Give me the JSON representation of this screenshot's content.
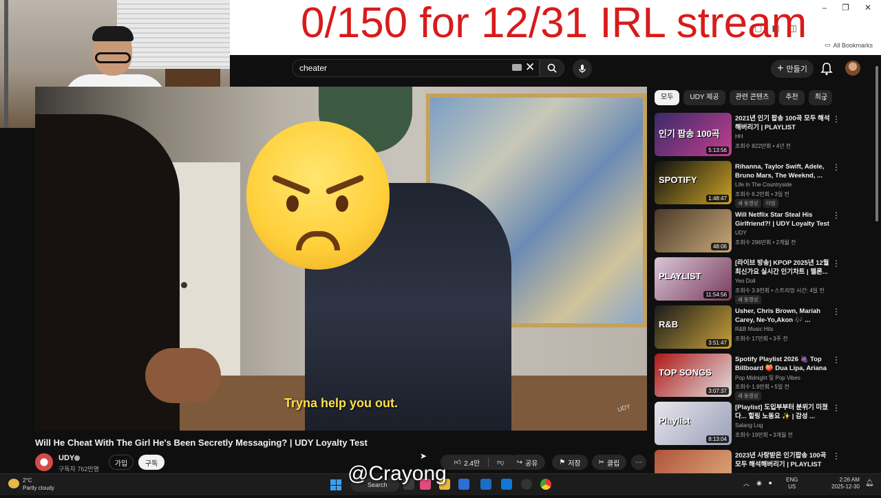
{
  "overlay": {
    "banner_text": "0/150 for 12/31 IRL stream"
  },
  "browser": {
    "bookmarks_label": "All Bookmarks",
    "window_buttons": [
      "–",
      "❐",
      "✕"
    ]
  },
  "header": {
    "search_value": "cheater",
    "clear_symbol": "✕",
    "create_label": "만들기",
    "create_symbol": "+"
  },
  "video": {
    "subtitle": "Tryna help you out.",
    "title": "Will He Cheat With The Girl He's Been Secretly Messaging? | UDY Loyalty Test",
    "channel": "UDY",
    "subscribers": "구독자 762만명",
    "join_label": "가입",
    "subscribe_label": "구독",
    "likes": "2.4만",
    "share_label": "공유",
    "save_label": "저장",
    "clip_label": "클립",
    "more_symbol": "⋯"
  },
  "chips": [
    "모두",
    "UDY 제공",
    "관련 콘텐츠",
    "추천",
    "최근"
  ],
  "recommendations": [
    {
      "title": "2021년 인기 팝송 100곡 모두 해석 해버리기 | PLAYLIST",
      "channel": "HH",
      "meta": "조회수 822만회 • 4년 전",
      "duration": "5:13:56",
      "thumb_text": "인기 팝송 100곡",
      "colors": [
        "#3b2a6b",
        "#c23f8c"
      ]
    },
    {
      "title": "Rihanna, Taylor Swift, Adele, Bruno Mars, The Weeknd, ...",
      "channel": "Life In The Countryside",
      "meta": "조회수 6.2만회 • 3일 전",
      "duration": "1:48:47",
      "badge": "새 동영상",
      "badge2": "더빙",
      "thumb_text": "SPOTIFY",
      "colors": [
        "#101010",
        "#c9a227"
      ]
    },
    {
      "title": "Will Netflix Star Steal His Girlfriend?! | UDY Loyalty Test",
      "channel": "UDY",
      "meta": "조회수 296만회 • 2개월 전",
      "duration": "48:06",
      "thumb_text": "",
      "colors": [
        "#4a3a2a",
        "#c9a878"
      ]
    },
    {
      "title": "[라이브 방송] KPOP 2025년 12월 최신가요 실시간 인기차트 | 멜론...",
      "channel": "Yeo Doll",
      "meta": "조회수 3.9천회 • 스트리밍 시간: 4일 전",
      "duration": "11:54:56",
      "badge": "새 동영상",
      "thumb_text": "PLAYLIST",
      "colors": [
        "#d8c7d6",
        "#7a3b5d"
      ]
    },
    {
      "title": "Usher, Chris Brown, Mariah Carey, Ne-Yo,Akon 🎶 ...",
      "channel": "R&B Music Hits",
      "meta": "조회수 17만회 • 3주 전",
      "duration": "3:51:47",
      "thumb_text": "R&B",
      "colors": [
        "#1b1b1b",
        "#c7a03a"
      ]
    },
    {
      "title": "Spotify Playlist 2026 🍇 Top Billboard 🍑 Dua Lipa, Ariana ...",
      "channel": "Pop Midnight 및 Pop Vibes",
      "meta": "조회수 1.9만회 • 5일 전",
      "duration": "3:07:37",
      "badge": "새 동영상",
      "thumb_text": "TOP SONGS",
      "colors": [
        "#b01818",
        "#e0e0e0"
      ]
    },
    {
      "title": "[Playlist] 도입부부터 분위기 미쳤다... 힐링 노동요 ✨ | 감성 ...",
      "channel": "Salang Log",
      "meta": "조회수 19만회 • 3개월 전",
      "duration": "8:13:04",
      "thumb_text": "Playlist",
      "colors": [
        "#e8e4ec",
        "#9aa0b8"
      ]
    },
    {
      "title": "2023년 사랑받은 인기팝송 100곡 모두 해석해버리기 | PLAYLIST",
      "channel": "",
      "meta": "",
      "duration": "",
      "thumb_text": "",
      "colors": [
        "#b0533a",
        "#e0b080"
      ]
    }
  ],
  "taskbar": {
    "temp": "2°C",
    "weather": "Partly cloudy",
    "search_label": "Search",
    "lang_top": "ENG",
    "lang_bottom": "US",
    "time": "2:26 AM",
    "date": "2025-12-30"
  },
  "stream_watermark": "@Crayong",
  "colors": {
    "banner_red": "#d81b1b",
    "yt_bg": "#0f0f0f",
    "subtitle_yellow": "#ffe14a"
  }
}
